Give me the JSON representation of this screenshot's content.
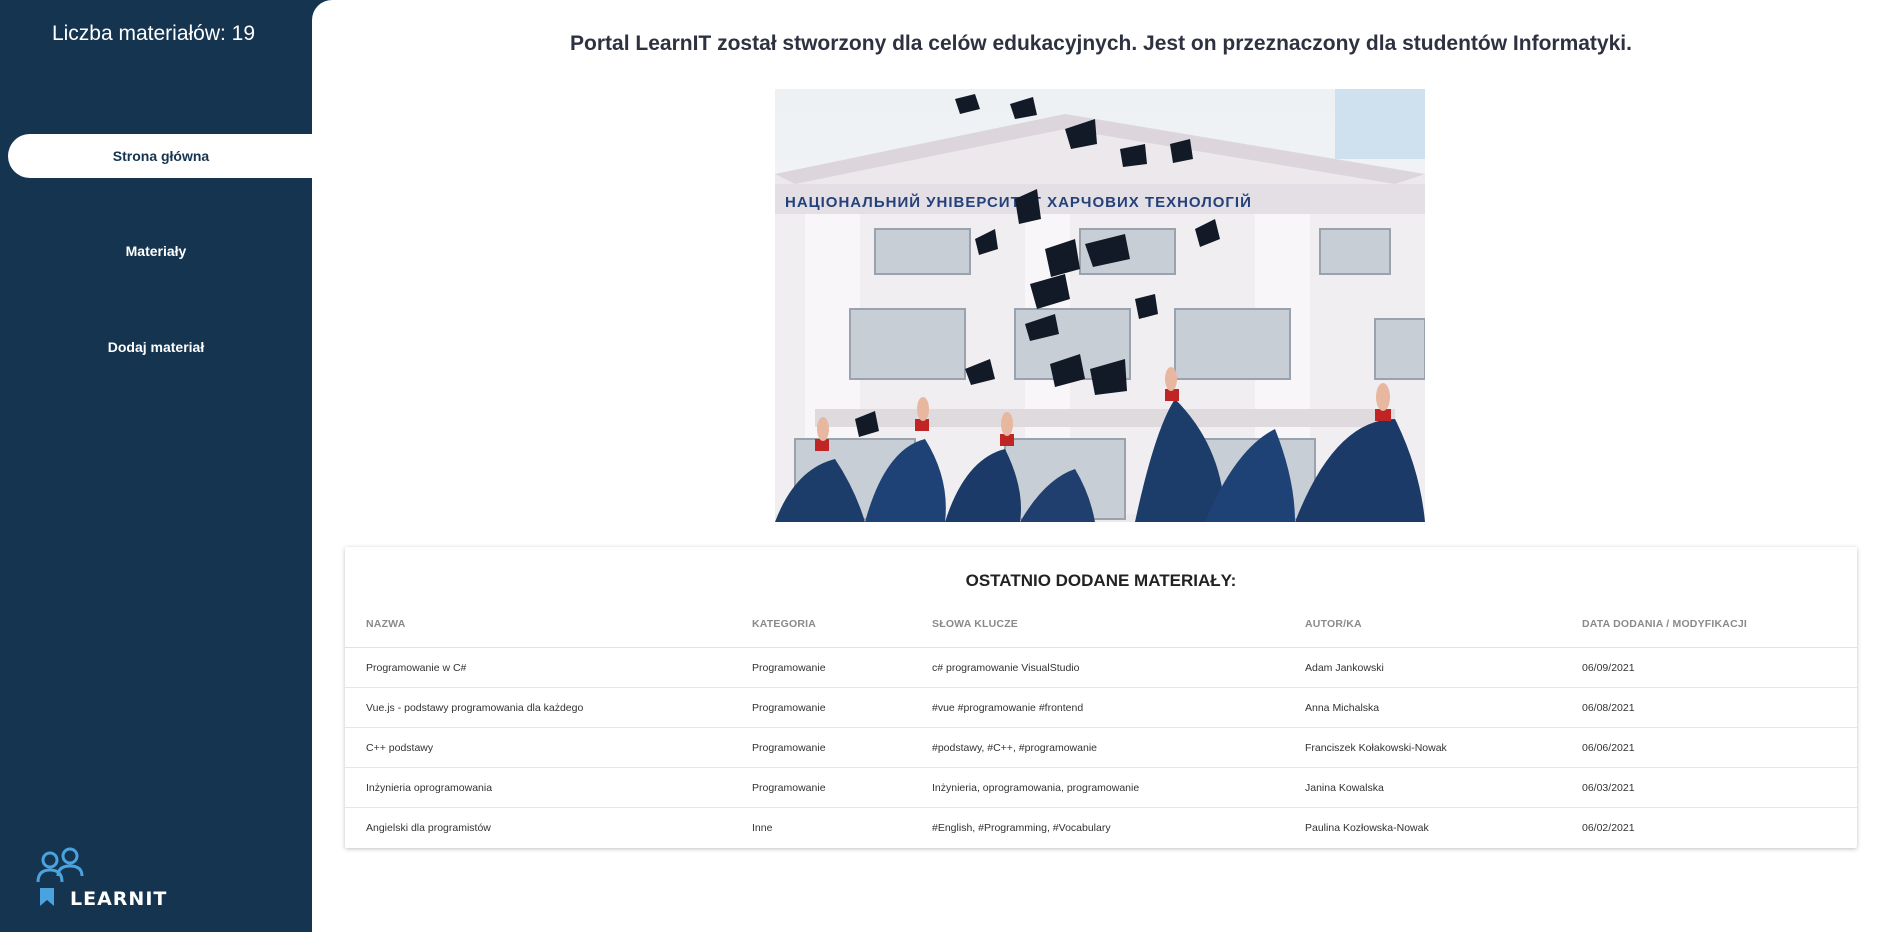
{
  "sidebar": {
    "counter": "Liczba materiałów: 19",
    "nav": [
      {
        "label": "Strona główna",
        "active": true
      },
      {
        "label": "Materiały",
        "active": false
      },
      {
        "label": "Dodaj materiał",
        "active": false
      }
    ],
    "logo_text": "LEARNIT",
    "logo_icon": "people-icon"
  },
  "main": {
    "intro": "Portal LearnIT został stworzony dla celów edukacyjnych. Jest on przeznaczony dla studentów Informatyki.",
    "hero_icon": "graduation-photo"
  },
  "recent": {
    "title": "OSTATNIO DODANE MATERIAŁY:",
    "columns": [
      "NAZWA",
      "KATEGORIA",
      "SŁOWA KLUCZE",
      "AUTOR/KA",
      "DATA DODANIA / MODYFIKACJI"
    ],
    "rows": [
      [
        "Programowanie w C#",
        "Programowanie",
        "c# programowanie VisualStudio",
        "Adam Jankowski",
        "06/09/2021"
      ],
      [
        "Vue.js - podstawy programowania dla każdego",
        "Programowanie",
        "#vue #programowanie #frontend",
        "Anna Michalska",
        "06/08/2021"
      ],
      [
        "C++ podstawy",
        "Programowanie",
        "#podstawy, #C++, #programowanie",
        "Franciszek Kołakowski-Nowak",
        "06/06/2021"
      ],
      [
        "Inżynieria oprogramowania",
        "Programowanie",
        "Inżynieria, oprogramowania, programowanie",
        "Janina Kowalska",
        "06/03/2021"
      ],
      [
        "Angielski dla programistów",
        "Inne",
        "#English, #Programming, #Vocabulary",
        "Paulina Kozłowska-Nowak",
        "06/02/2021"
      ]
    ]
  },
  "colors": {
    "sidebar": "#14344f",
    "accent_icon": "#4aa3df"
  }
}
